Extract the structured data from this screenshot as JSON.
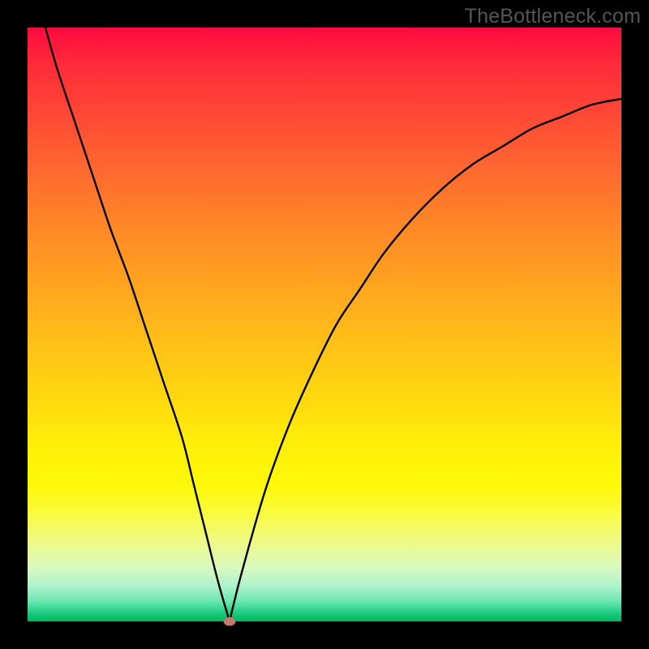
{
  "watermark": "TheBottleneck.com",
  "colors": {
    "frame": "#000000",
    "curve": "#000000",
    "marker": "#c07a6a"
  },
  "chart_data": {
    "type": "line",
    "title": "",
    "xlabel": "",
    "ylabel": "",
    "xlim": [
      0,
      100
    ],
    "ylim": [
      0,
      100
    ],
    "legend": false,
    "grid": false,
    "series": [
      {
        "name": "bottleneck-curve",
        "x": [
          3,
          5,
          8,
          11,
          14,
          17,
          20,
          23,
          26,
          28,
          30,
          32,
          34,
          36,
          40,
          44,
          48,
          52,
          56,
          60,
          65,
          70,
          75,
          80,
          85,
          90,
          95,
          100
        ],
        "y": [
          100,
          93,
          84,
          75,
          66,
          58,
          49,
          40,
          31,
          23,
          15,
          7,
          0,
          8,
          22,
          33,
          42,
          50,
          56,
          62,
          68,
          73,
          77,
          80,
          83,
          85,
          87,
          88
        ]
      }
    ],
    "marker": {
      "x": 34,
      "y": 0,
      "name": "optimal-point"
    },
    "background_gradient": {
      "orientation": "vertical",
      "stops": [
        {
          "pos": 0,
          "color": "#ff0a3f"
        },
        {
          "pos": 0.5,
          "color": "#ffbd18"
        },
        {
          "pos": 0.78,
          "color": "#fef908"
        },
        {
          "pos": 1.0,
          "color": "#00b85b"
        }
      ]
    }
  }
}
